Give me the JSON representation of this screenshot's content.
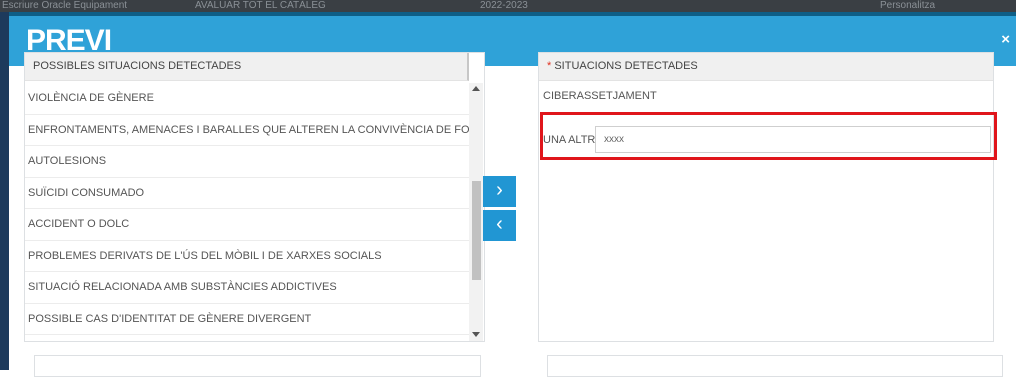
{
  "background": {
    "items": [
      "Escriure Oracle Equipament",
      "AVALUAR TOT EL CATÀLEG",
      "2022-2023",
      "Personalitza"
    ]
  },
  "dialog": {
    "title": "PREVI",
    "close_label": "×",
    "header_color": "#2fa2d8"
  },
  "possible": {
    "header": "POSSIBLES SITUACIONS DETECTADES",
    "items": [
      "VIOLÈNCIA DE GÈNERE",
      "ENFRONTAMENTS, AMENACES I BARALLES QUE ALTEREN LA CONVIVÈNCIA DE FORMA GREU ENTRE L'ALUMNAT",
      "AUTOLESIONS",
      "SUÏCIDI CONSUMADO",
      "ACCIDENT O DOLC",
      "PROBLEMES DERIVATS DE L'ÚS DEL MÒBIL I DE XARXES SOCIALS",
      "SITUACIÓ RELACIONADA AMB SUBSTÀNCIES ADDICTIVES",
      "POSSIBLE CAS D'IDENTITAT DE GÈNERE DIVERGENT"
    ]
  },
  "transfer": {
    "add_label": "›",
    "remove_label": "‹",
    "button_color": "#2196d3"
  },
  "detected": {
    "required_mark": "*",
    "header": "SITUACIONS DETECTADES",
    "items": [
      "CIBERASSETJAMENT"
    ],
    "other_label": "UNA ALTRA",
    "other_value": "xxxx"
  },
  "highlight_color": "#e0151b"
}
